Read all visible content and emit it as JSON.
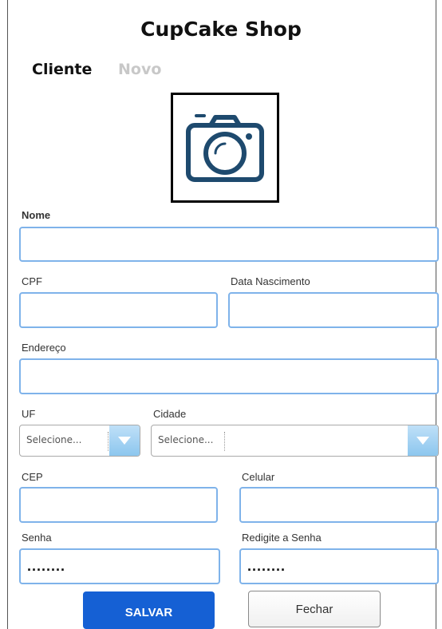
{
  "app": {
    "title": "CupCake Shop"
  },
  "tabs": {
    "active": "Cliente",
    "inactive": "Novo"
  },
  "photo": {
    "icon": "camera-icon",
    "color": "#1e4a6e"
  },
  "form": {
    "nome_label": "Nome",
    "nome_value": "",
    "cpf_label": "CPF",
    "cpf_value": "",
    "nascimento_label": "Data Nascimento",
    "nascimento_value": "",
    "endereco_label": "Endereço",
    "endereco_value": "",
    "uf_label": "UF",
    "uf_selected": "Selecione...",
    "cidade_label": "Cidade",
    "cidade_selected": "Selecione...",
    "cep_label": "CEP",
    "cep_value": "",
    "celular_label": "Celular",
    "celular_value": "",
    "senha_label": "Senha",
    "senha_value": "........",
    "redigite_label": "Redigite a Senha",
    "redigite_value": "........"
  },
  "buttons": {
    "save": "SALVAR",
    "close": "Fechar"
  },
  "colors": {
    "accent": "#1560d4",
    "field_border": "#7fb3ea"
  }
}
